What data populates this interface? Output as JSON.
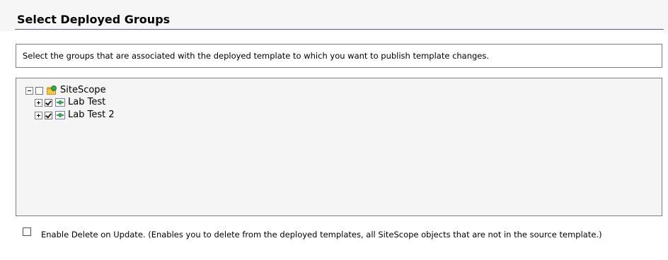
{
  "header": {
    "title": "Select Deployed Groups"
  },
  "instructions": {
    "text": "Select the groups that are associated with the deployed template to which you want to publish template changes."
  },
  "tree": {
    "root": {
      "label": "SiteScope",
      "expanded": true,
      "checked": false,
      "icon": "sitescope-folder-icon"
    },
    "children": [
      {
        "label": "Lab Test",
        "expanded": false,
        "checked": true,
        "icon": "group-icon"
      },
      {
        "label": "Lab Test 2",
        "expanded": false,
        "checked": true,
        "icon": "group-icon"
      }
    ]
  },
  "options": {
    "enable_delete": {
      "label": "Enable Delete on Update. (Enables you to delete from the deployed templates, all SiteScope objects that are not in the source template.)",
      "checked": false
    }
  },
  "colors": {
    "title_rule": "#55607a",
    "border": "#7d7d7d",
    "tree_background": "#f5f5f5",
    "header_background": "#f7f7f7"
  }
}
